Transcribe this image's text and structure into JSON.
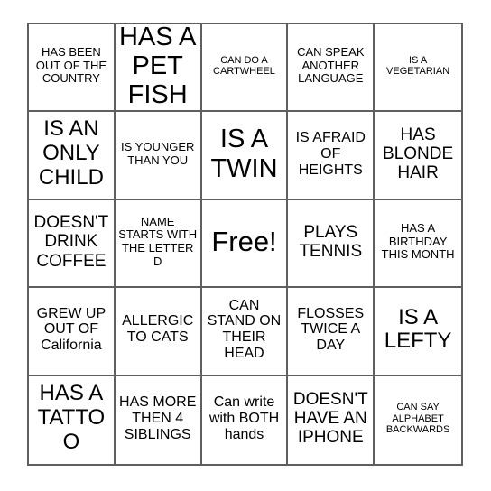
{
  "card": {
    "type": "human-bingo-card",
    "grid": {
      "columns": 5,
      "rows": 5
    },
    "colors": {
      "background": "#ffffff",
      "border": "#5f5f5f",
      "text": "#000000"
    },
    "cells": [
      {
        "id": "r1c1",
        "text": "HAS BEEN OUT OF THE COUNTRY",
        "size": "sm",
        "free": false
      },
      {
        "id": "r1c2",
        "text": "HAS A PET FISH",
        "size": "xxl",
        "free": false
      },
      {
        "id": "r1c3",
        "text": "CAN DO A CARTWHEEL",
        "size": "xs",
        "free": false
      },
      {
        "id": "r1c4",
        "text": "CAN SPEAK ANOTHER LANGUAGE",
        "size": "sm",
        "free": false
      },
      {
        "id": "r1c5",
        "text": "IS A VEGETARIAN",
        "size": "xs",
        "free": false
      },
      {
        "id": "r2c1",
        "text": "IS AN ONLY CHILD",
        "size": "xl",
        "free": false
      },
      {
        "id": "r2c2",
        "text": "IS YOUNGER THAN YOU",
        "size": "sm",
        "free": false
      },
      {
        "id": "r2c3",
        "text": "IS A TWIN",
        "size": "xxl",
        "free": false
      },
      {
        "id": "r2c4",
        "text": "IS AFRAID OF HEIGHTS",
        "size": "md",
        "free": false
      },
      {
        "id": "r2c5",
        "text": "HAS BLONDE HAIR",
        "size": "lg",
        "free": false
      },
      {
        "id": "r3c1",
        "text": "DOESN'T DRINK COFFEE",
        "size": "lg",
        "free": false
      },
      {
        "id": "r3c2",
        "text": "NAME STARTS WITH THE LETTER D",
        "size": "sm",
        "free": false
      },
      {
        "id": "r3c3",
        "text": "Free!",
        "size": "free",
        "free": true
      },
      {
        "id": "r3c4",
        "text": "PLAYS TENNIS",
        "size": "lg",
        "free": false
      },
      {
        "id": "r3c5",
        "text": "HAS A BIRTHDAY THIS MONTH",
        "size": "sm",
        "free": false
      },
      {
        "id": "r4c1",
        "text": "GREW UP OUT OF California",
        "size": "md",
        "free": false
      },
      {
        "id": "r4c2",
        "text": "ALLERGIC TO CATS",
        "size": "md",
        "free": false
      },
      {
        "id": "r4c3",
        "text": "CAN STAND ON THEIR HEAD",
        "size": "md",
        "free": false
      },
      {
        "id": "r4c4",
        "text": "FLOSSES TWICE A DAY",
        "size": "md",
        "free": false
      },
      {
        "id": "r4c5",
        "text": "IS A LEFTY",
        "size": "xl",
        "free": false
      },
      {
        "id": "r5c1",
        "text": "HAS A TATTOO",
        "size": "xl",
        "free": false
      },
      {
        "id": "r5c2",
        "text": "HAS MORE THEN 4 SIBLINGS",
        "size": "md",
        "free": false
      },
      {
        "id": "r5c3",
        "text": "Can write with BOTH hands",
        "size": "md",
        "free": false
      },
      {
        "id": "r5c4",
        "text": "DOESN'T HAVE AN IPHONE",
        "size": "lg",
        "free": false
      },
      {
        "id": "r5c5",
        "text": "CAN SAY ALPHABET BACKWARDS",
        "size": "xs",
        "free": false
      }
    ]
  }
}
